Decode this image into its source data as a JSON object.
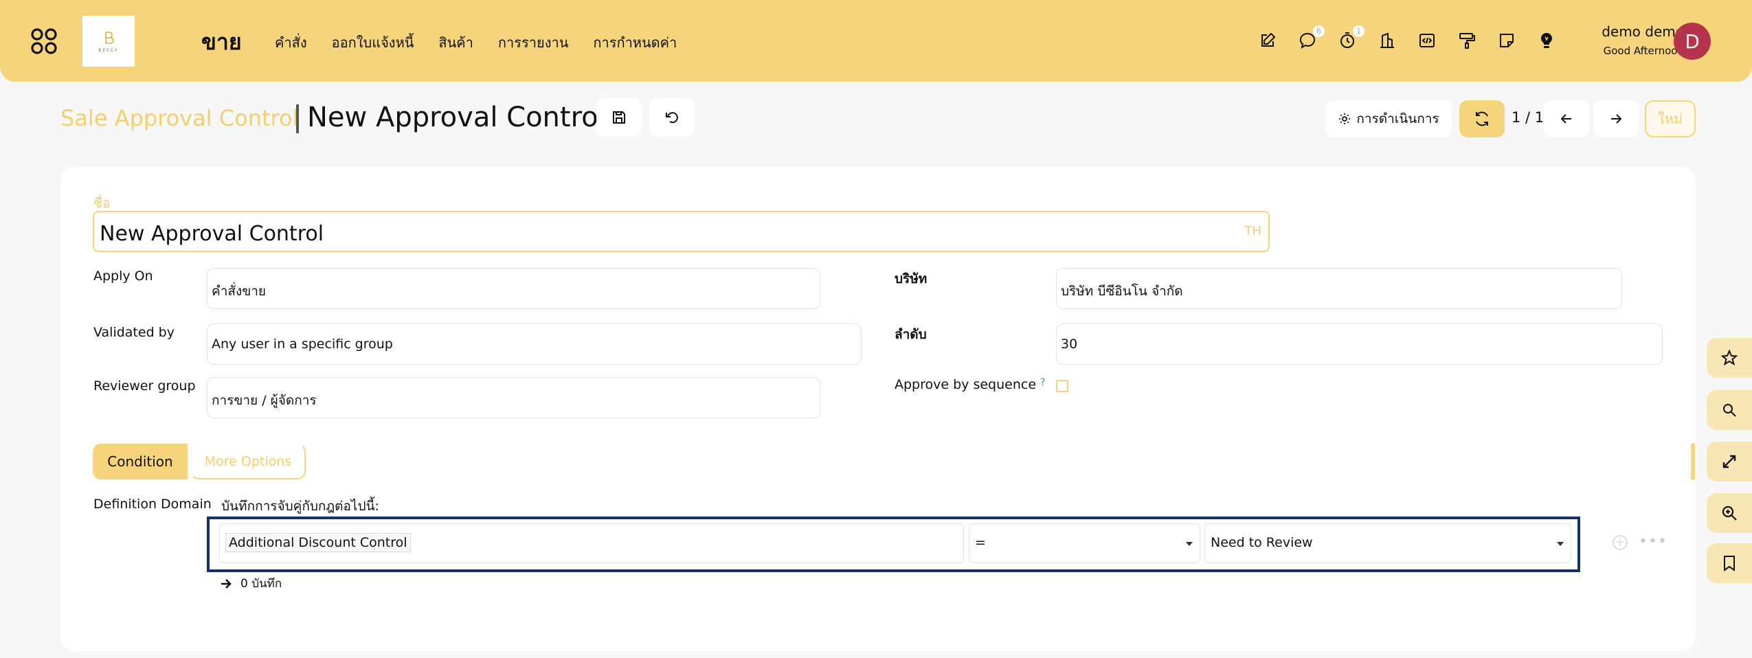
{
  "navbar": {
    "brand_word": "BEECY",
    "app_name": "ขาย",
    "menu": [
      "คำสั่ง",
      "ออกใบแจ้งหนี้",
      "สินค้า",
      "การรายงาน",
      "การกำหนดค่า"
    ],
    "icons": [
      "edit-icon",
      "chat-icon",
      "timer-icon",
      "building-icon",
      "code-icon",
      "paint-roller-icon",
      "note-icon",
      "lightbulb-icon"
    ],
    "chat_badge": "6",
    "activity_badge": "1",
    "user_name": "demo demo",
    "greeting": "Good Afternoon",
    "avatar_initial": "D"
  },
  "control_panel": {
    "breadcrumb_parent": "Sale Approval Control",
    "breadcrumb_current": "New Approval Control",
    "action_label": "การดำเนินการ",
    "pager": "1 / 1",
    "new_label": "ใหม่"
  },
  "form": {
    "name_label": "ชื่อ",
    "name_value": "New Approval Control",
    "lang": "TH",
    "apply_on_label": "Apply On",
    "apply_on_value": "คำสั่งขาย",
    "company_label": "บริษัท",
    "company_value": "บริษัท บีซีอินโน จำกัด",
    "validated_by_label": "Validated by",
    "validated_by_value": "Any user in a specific group",
    "sequence_label": "ลำดับ",
    "sequence_value": "30",
    "reviewer_group_label": "Reviewer group",
    "reviewer_group_value": "การขาย / ผู้จัดการ",
    "approve_by_sequence_label": "Approve by sequence",
    "approve_by_sequence_help": "?",
    "approve_by_sequence_checked": false
  },
  "tabs": {
    "condition": "Condition",
    "more_options": "More Options"
  },
  "domain": {
    "label": "Definition Domain",
    "header": "บันทึกการจับคู่กับกฎต่อไปนี้:",
    "rule": {
      "field": "Additional Discount Control",
      "operator": "=",
      "value": "Need to Review"
    },
    "records": "0 บันทึก"
  },
  "dock": [
    "star-icon",
    "search-icon",
    "expand-icon",
    "zoom-in-icon",
    "bookmark-icon"
  ],
  "colors": {
    "brand": "#f6d47c",
    "brand_text": "#f3cf6f",
    "avatar": "#b6344b",
    "rule_border": "#13306b"
  }
}
